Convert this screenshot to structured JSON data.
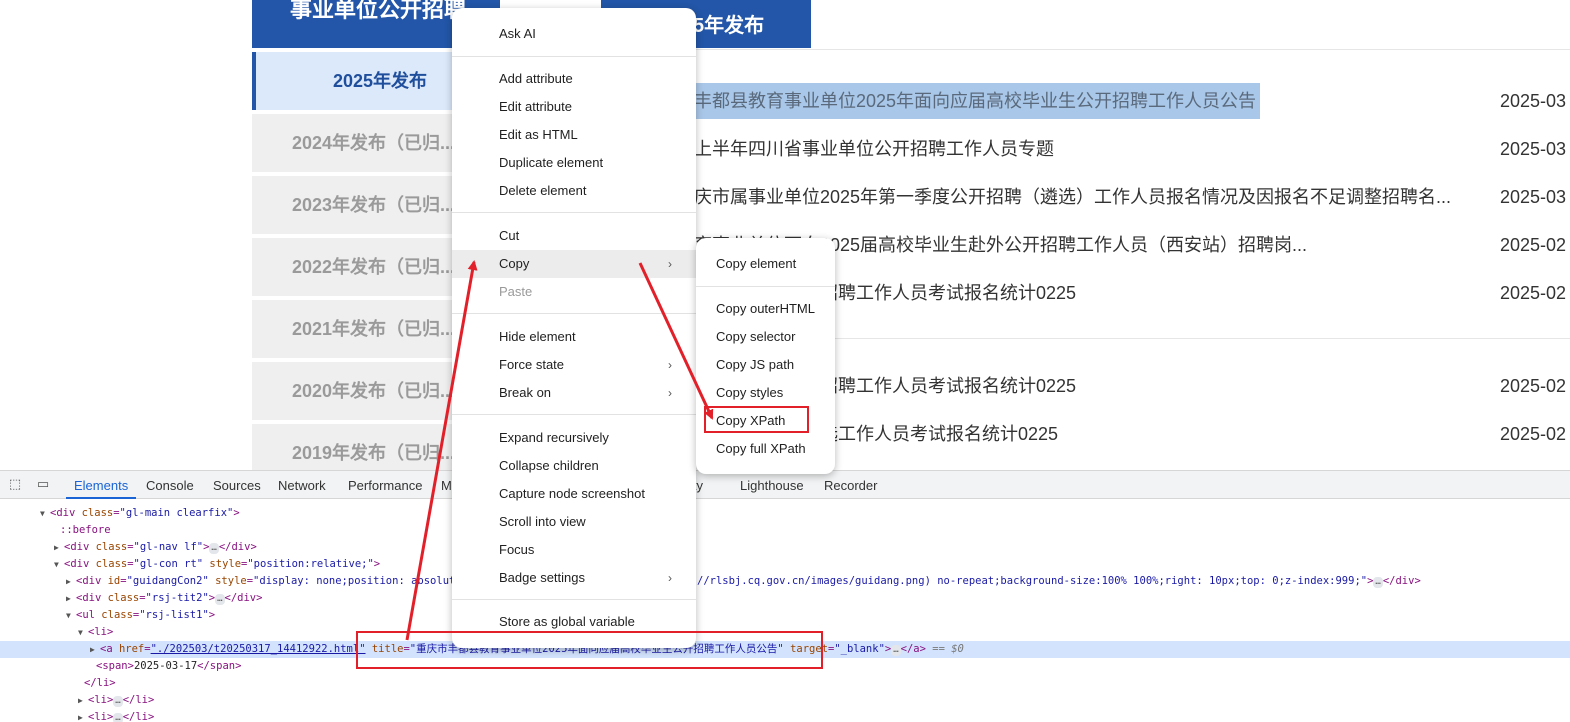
{
  "sidebar": {
    "header": "事业单位公开招聘",
    "items": [
      {
        "label": "2025年发布",
        "active": true
      },
      {
        "label": "2024年发布（已归..."
      },
      {
        "label": "2023年发布（已归..."
      },
      {
        "label": "2022年发布（已归..."
      },
      {
        "label": "2021年发布（已归..."
      },
      {
        "label": "2020年发布（已归..."
      },
      {
        "label": "2019年发布（已归..."
      }
    ]
  },
  "main": {
    "tab": "5年发布",
    "news": [
      {
        "title": "丰都县教育事业单位2025年面向应届高校毕业生公开招聘工作人员公告",
        "date": "2025-03"
      },
      {
        "title": "上半年四川省事业单位公开招聘工作人员专题",
        "date": "2025-03"
      },
      {
        "title": "庆市属事业单位2025年第一季度公开招聘（遴选）工作人员报名情况及因报名不足调整招聘名...",
        "date": "2025-03"
      },
      {
        "title": "育事业单位面向2025届高校毕业生赴外公开招聘工作人员（西安站）招聘岗...",
        "date": "2025-02"
      },
      {
        "title": "年第一季度公开招聘工作人员考试报名统计0225",
        "date": "2025-02"
      },
      {
        "title": "年第一季度考核招聘工作人员考试报名统计0225",
        "date": "2025-02"
      },
      {
        "title": "第一季度公开遴选工作人员考试报名统计0225",
        "date": "2025-02"
      }
    ]
  },
  "context_menu": {
    "items": {
      "ask_ai": "Ask AI",
      "add_attribute": "Add attribute",
      "edit_attribute": "Edit attribute",
      "edit_as_html": "Edit as HTML",
      "duplicate_element": "Duplicate element",
      "delete_element": "Delete element",
      "cut": "Cut",
      "copy": "Copy",
      "paste": "Paste",
      "hide_element": "Hide element",
      "force_state": "Force state",
      "break_on": "Break on",
      "expand_recursively": "Expand recursively",
      "collapse_children": "Collapse children",
      "capture_node_screenshot": "Capture node screenshot",
      "scroll_into_view": "Scroll into view",
      "focus": "Focus",
      "badge_settings": "Badge settings",
      "store_as_global_variable": "Store as global variable"
    },
    "chevron": "›"
  },
  "copy_submenu": {
    "copy_element": "Copy element",
    "copy_outerhtml": "Copy outerHTML",
    "copy_selector": "Copy selector",
    "copy_js_path": "Copy JS path",
    "copy_styles": "Copy styles",
    "copy_xpath": "Copy XPath",
    "copy_full_xpath": "Copy full XPath"
  },
  "devtools": {
    "tabs": [
      "Elements",
      "Console",
      "Sources",
      "Network",
      "Performance",
      "M",
      "ity",
      "Lighthouse",
      "Recorder"
    ],
    "active_tab": "Elements",
    "code": {
      "l0": "<div class=\"gl-main clearfix\">",
      "l0_tag_open": "<div ",
      "l0_attr": "class",
      "l0_val": "\"gl-main clearfix\"",
      "before": "::before",
      "nav_attr_val": "\"gl-nav lf\"",
      "con_val": "\"gl-con rt\"",
      "con_style": "\"position:relative;\"",
      "guidang_id": "\"guidangCon2\"",
      "guidang_style_start": "\"display: none;position: absolute;w",
      "guidang_style_end": "//rlsbj.cq.gov.cn/images/guidang.png) no-repeat;background-size:100% 100%;right: 10px;top: 0;z-index:999;\"",
      "tit2_val": "\"rsj-tit2\"",
      "list_val": "\"rsj-list1\"",
      "href_val": "\"./202503/t20250317_14412922.html\"",
      "title_val": "\"重庆市丰都县教育事业单位2025年面向应届高校毕业生公开招聘工作人员公告\"",
      "target_val": "\"_blank\"",
      "span_text": "2025-03-17",
      "dollar": "== $0",
      "ellipsis": "…"
    }
  },
  "colors": {
    "brand_blue": "#2356a8",
    "annotation_red": "#e2202a"
  }
}
